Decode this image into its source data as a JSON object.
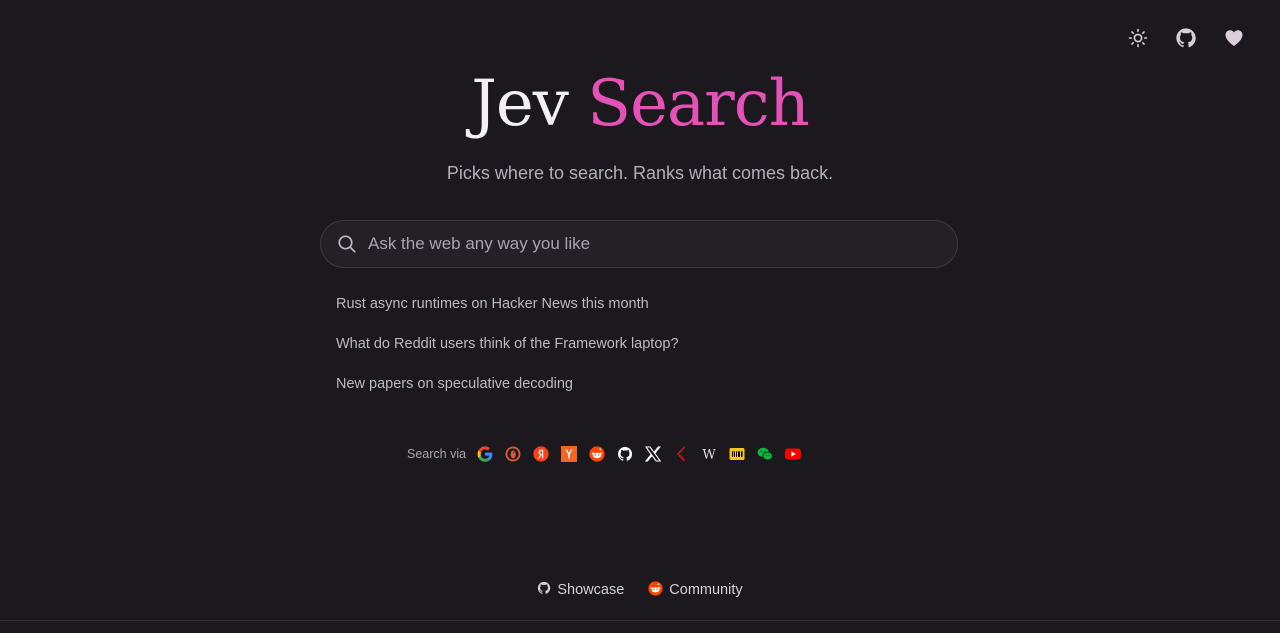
{
  "header": {
    "icons": [
      "sun-icon",
      "github-icon",
      "heart-icon"
    ]
  },
  "title": {
    "part1": "Jev",
    "part2": "Search",
    "colors": {
      "part1": "#f3eff4",
      "part2": "#e452b8"
    }
  },
  "subtitle": "Picks where to search. Ranks what comes back.",
  "search": {
    "placeholder": "Ask the web any way you like",
    "value": ""
  },
  "suggestions": [
    "Rust async runtimes on Hacker News this month",
    "What do Reddit users think of the Framework laptop?",
    "New papers on speculative decoding"
  ],
  "engines": {
    "label": "Search via",
    "items": [
      "google-icon",
      "duckduckgo-icon",
      "yandex-icon",
      "hacker-news-icon",
      "reddit-icon",
      "github-icon",
      "x-icon",
      "arxiv-icon",
      "wikipedia-icon",
      "imdb-icon",
      "wechat-icon",
      "youtube-icon"
    ]
  },
  "footer": {
    "showcase": "Showcase",
    "community": "Community"
  }
}
